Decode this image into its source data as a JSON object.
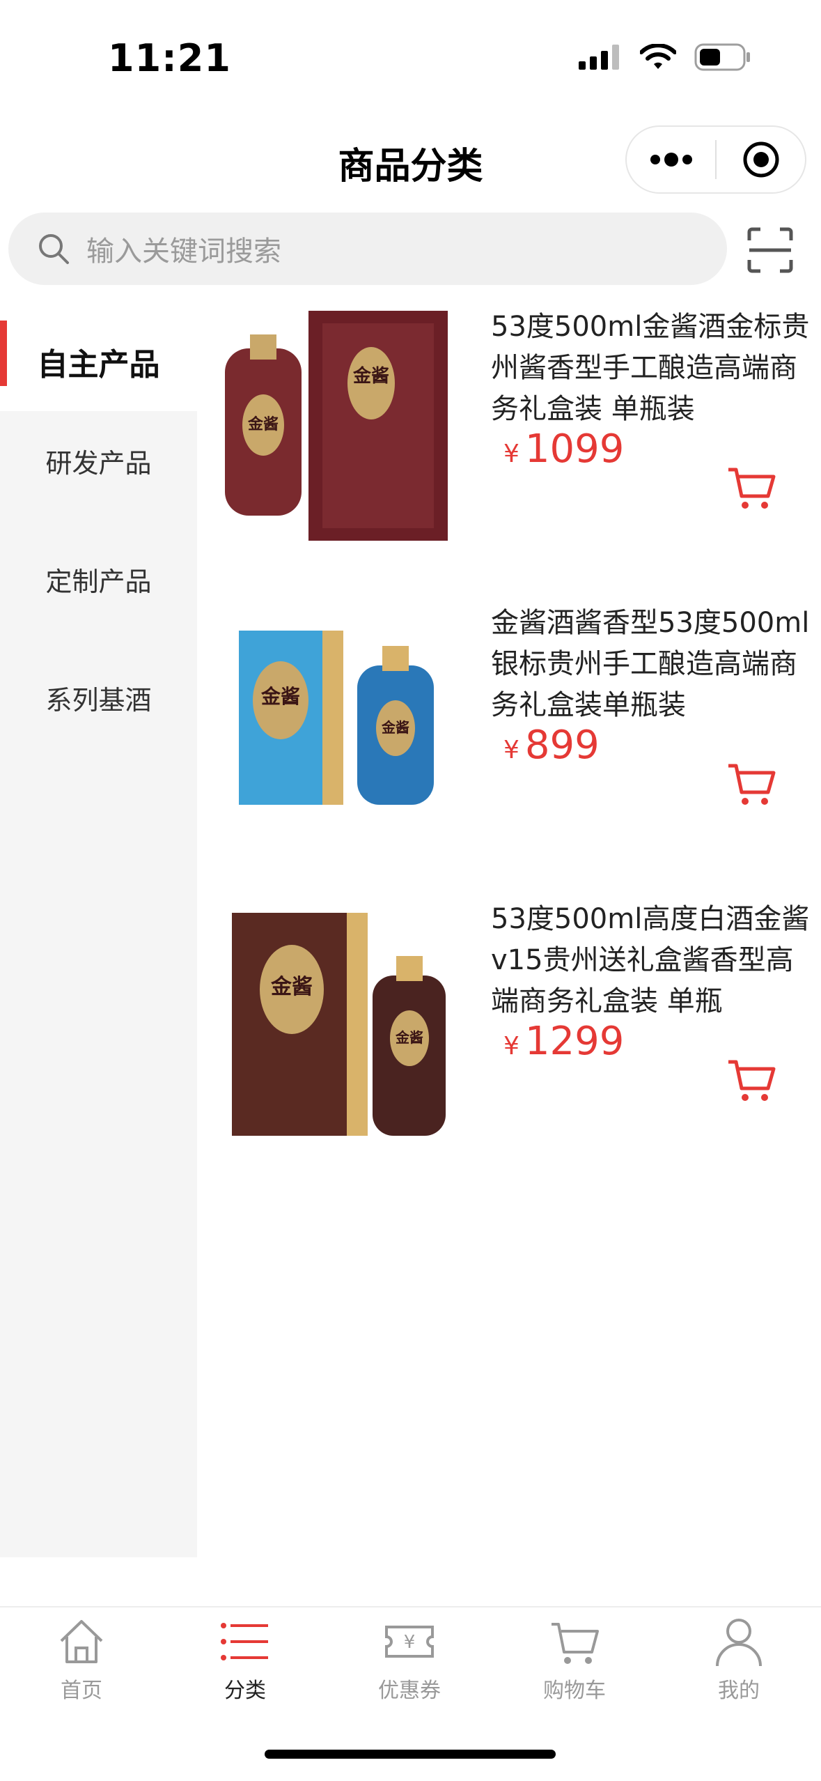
{
  "status_bar": {
    "time": "11:21",
    "battery_level": 0.5
  },
  "header": {
    "title": "商品分类",
    "more_icon": "more-dots-icon",
    "close_icon": "target-circle-icon"
  },
  "search": {
    "placeholder": "输入关键词搜索",
    "icon": "search-icon",
    "scan_icon": "scan-icon"
  },
  "sidebar": {
    "items": [
      {
        "label": "自主产品",
        "active": true
      },
      {
        "label": "研发产品",
        "active": false
      },
      {
        "label": "定制产品",
        "active": false
      },
      {
        "label": "系列基酒",
        "active": false
      }
    ]
  },
  "products": [
    {
      "name": "53度500ml金酱酒金标贵州酱香型手工酿造高端商务礼盒装 单瓶装",
      "currency": "¥",
      "price": "1099",
      "box_color": "#6b1f26",
      "bottle_color": "#7a2a2e"
    },
    {
      "name": "金酱酒酱香型53度500ml银标贵州手工酿造高端商务礼盒装单瓶装",
      "currency": "¥",
      "price": "899",
      "box_color": "#3fa3d8",
      "bottle_color": "#2a78b8"
    },
    {
      "name": "53度500ml高度白酒金酱v15贵州送礼盒酱香型高端商务礼盒装 单瓶",
      "currency": "¥",
      "price": "1299",
      "box_color": "#5a2a22",
      "bottle_color": "#4a2320"
    }
  ],
  "product_image_text": "金酱",
  "tabs": [
    {
      "label": "首页",
      "icon": "home-icon",
      "active": false
    },
    {
      "label": "分类",
      "icon": "category-list-icon",
      "active": true
    },
    {
      "label": "优惠券",
      "icon": "coupon-icon",
      "active": false
    },
    {
      "label": "购物车",
      "icon": "cart-icon",
      "active": false
    },
    {
      "label": "我的",
      "icon": "user-icon",
      "active": false
    }
  ],
  "colors": {
    "accent": "#e53935",
    "sidebar_bg": "#f5f5f5",
    "search_bg": "#f0f0f0"
  }
}
